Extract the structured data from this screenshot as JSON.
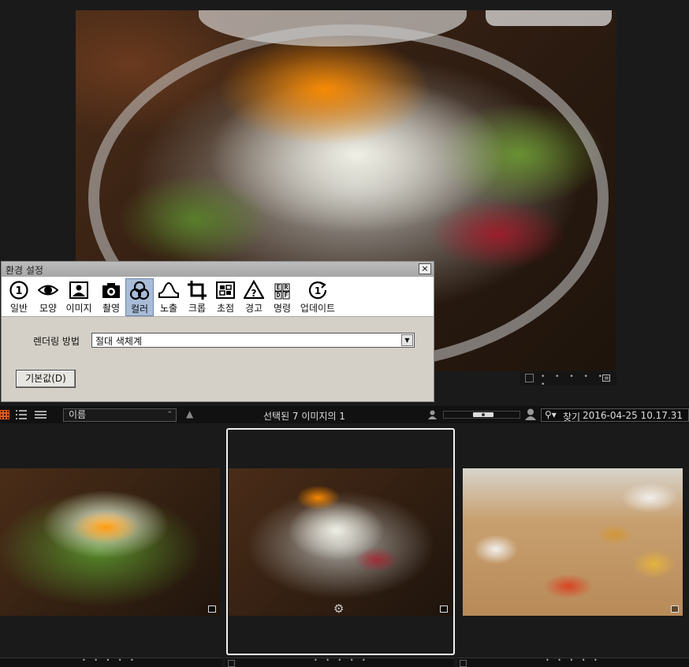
{
  "preferences_dialog": {
    "title": "환경 설정",
    "close": "×",
    "tabs": [
      {
        "label": "일반",
        "icon": "general-icon"
      },
      {
        "label": "모양",
        "icon": "eye-icon"
      },
      {
        "label": "이미지",
        "icon": "image-icon"
      },
      {
        "label": "촬영",
        "icon": "camera-icon"
      },
      {
        "label": "컬러",
        "icon": "color-circles-icon",
        "active": true
      },
      {
        "label": "노출",
        "icon": "exposure-icon"
      },
      {
        "label": "크롭",
        "icon": "crop-icon"
      },
      {
        "label": "초점",
        "icon": "focus-icon"
      },
      {
        "label": "경고",
        "icon": "warning-icon"
      },
      {
        "label": "명령",
        "icon": "command-icon"
      },
      {
        "label": "업데이트",
        "icon": "update-icon"
      }
    ],
    "rendering_method_label": "렌더링 방법",
    "rendering_method_value": "절대 색체계",
    "default_button": "기본값(D)"
  },
  "toolbar": {
    "sort_value": "이름",
    "sort_direction": "▲",
    "selection_status": "선택된 7 이미지의 1",
    "search_label": "찾기",
    "search_value": "2016-04-25 10.17.31"
  },
  "preview": {
    "dots": "• • • • • •"
  },
  "filmstrip": {
    "dots": "• • • • •"
  },
  "colors": {
    "accent": "#a8bcd8",
    "background": "#1a1a1a",
    "dialog": "#d4d0c8"
  }
}
